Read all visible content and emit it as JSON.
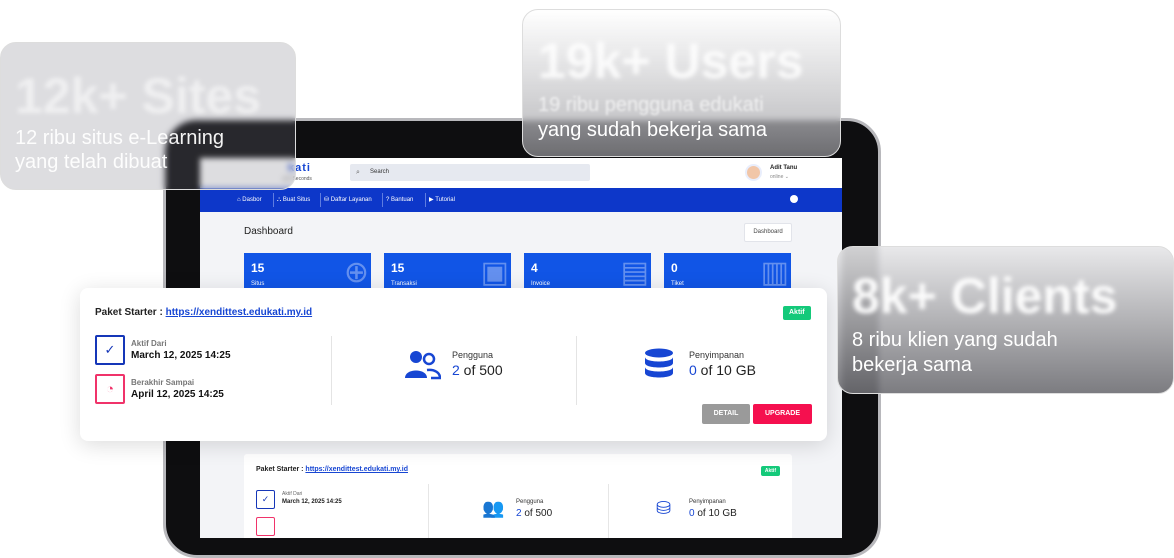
{
  "app": {
    "logo_text": "kati",
    "logo_tagline": "g in Seconds",
    "search_placeholder": "Search",
    "user": {
      "name": "Adit Tanu",
      "status": "online ⌄"
    }
  },
  "nav": {
    "items": [
      {
        "icon": "home-icon",
        "glyph": "⌂",
        "label": "Dasbor"
      },
      {
        "icon": "sitemap-icon",
        "glyph": "⛬",
        "label": "Buat Situs"
      },
      {
        "icon": "database-icon",
        "glyph": "⛁",
        "label": "Daftar Layanan"
      },
      {
        "icon": "help-icon",
        "glyph": "?",
        "label": "Bantuan"
      },
      {
        "icon": "video-icon",
        "glyph": "▶",
        "label": "Tutorial"
      }
    ]
  },
  "dashboard": {
    "title": "Dashboard",
    "breadcrumb": "Dashboard",
    "stats": [
      {
        "value": "15",
        "label": "Situs",
        "icon": "globe-icon",
        "glyph": "⊕"
      },
      {
        "value": "15",
        "label": "Transaksi",
        "icon": "money-icon",
        "glyph": "▣"
      },
      {
        "value": "4",
        "label": "Invoice",
        "icon": "document-icon",
        "glyph": "▤"
      },
      {
        "value": "0",
        "label": "Tiket",
        "icon": "ticket-icon",
        "glyph": "▥"
      }
    ]
  },
  "package": {
    "title_prefix": "Paket Starter : ",
    "url": "https://xendittest.edukati.my.id",
    "badge": "Aktif",
    "active_from_label": "Aktif Dari",
    "active_from_value": "March 12, 2025 14:25",
    "expires_label": "Berakhir Sampai",
    "expires_value": "April 12, 2025 14:25",
    "users_label": "Pengguna",
    "users_current": "2",
    "users_total": " of 500",
    "storage_label": "Penyimpanan",
    "storage_current": "0",
    "storage_total": " of 10 GB",
    "detail_button": "DETAIL",
    "upgrade_button": "UPGRADE"
  },
  "bubbles": [
    {
      "big": "12k+ Sites",
      "line1": "12 ribu situs e-Learning",
      "line2": "yang telah dibuat"
    },
    {
      "big": "19k+ Users",
      "line1": "19 ribu pengguna edukati",
      "line2": "yang sudah bekerja sama"
    },
    {
      "big": "8k+ Clients",
      "line1": "8 ribu klien yang sudah",
      "line2": "bekerja sama"
    }
  ]
}
